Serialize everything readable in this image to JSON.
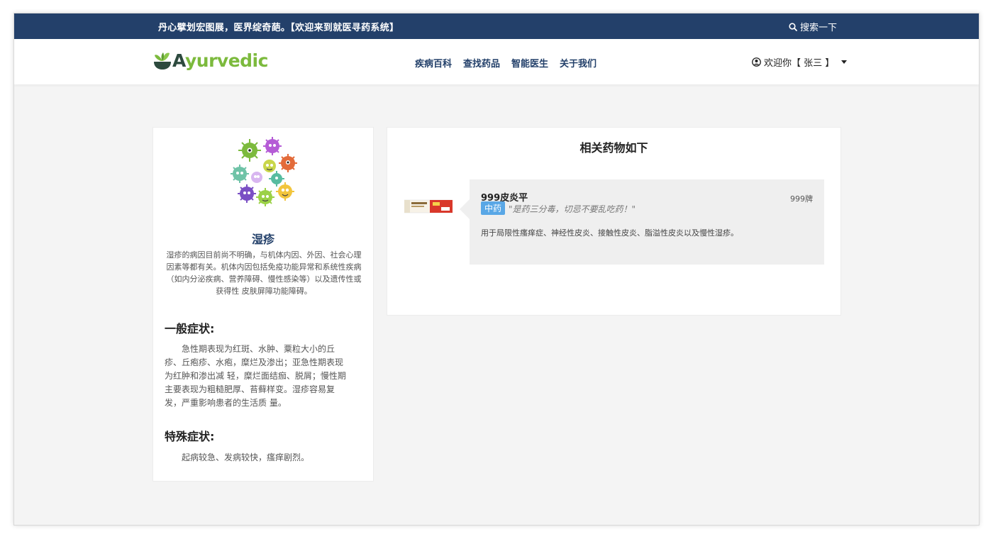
{
  "topbar": {
    "slogan": "丹心擘划宏图展，医界绽奇葩。【欢迎来到就医寻药系统】",
    "search_label": "搜索一下"
  },
  "brand": {
    "logo_text": "Ayurvedic"
  },
  "nav": {
    "items": [
      "疾病百科",
      "查找药品",
      "智能医生",
      "关于我们"
    ]
  },
  "user": {
    "greeting": "欢迎你【 张三 】"
  },
  "disease": {
    "name": "湿疹",
    "description": "湿疹的病因目前尚不明确，与机体内因、外因、社会心理因素等都有关。机体内因包括免疫功能异常和系统性疾病（如内分泌疾病、营养障碍、慢性感染等）以及遗传性或获得性 皮肤屏障功能障碍。",
    "general_heading": "一般症状:",
    "general_text": "急性期表现为红斑、水肿、粟粒大小的丘疹、丘疱疹、水疱，糜烂及渗出；亚急性期表现为红肿和渗出减 轻，糜烂面结痂、脱屑；慢性期主要表现为粗糙肥厚、苔藓样变。湿疹容易复发，严重影响患者的生活质 量。",
    "special_heading": "特殊症状:",
    "special_text": "起病较急、发病较快，瘙痒剧烈。"
  },
  "related": {
    "title": "相关药物如下",
    "drugs": [
      {
        "name": "999皮炎平",
        "brand": "999牌",
        "tag": "中药",
        "quote": "\"是药三分毒，切忌不要乱吃药！\"",
        "usage": "用于局限性瘙痒症、神经性皮炎、接触性皮炎、脂溢性皮炎以及慢性湿疹。"
      }
    ]
  },
  "colors": {
    "primary": "#23406a",
    "logo_green": "#7cba3d",
    "logo_dark": "#2d4a3e",
    "tag_blue": "#59a7e6"
  }
}
